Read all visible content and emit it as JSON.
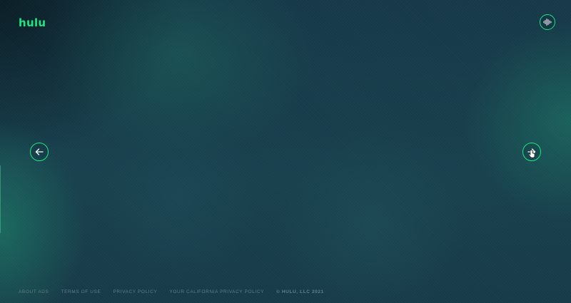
{
  "brand": {
    "logo_text": "hulu",
    "accent_color": "#1ce783"
  },
  "controls": {
    "audio_icon": "audio-wave-icon",
    "prev_icon": "arrow-left-icon",
    "next_icon": "arrow-right-icon"
  },
  "footer": {
    "links": [
      "ABOUT ADS",
      "TERMS OF USE",
      "PRIVACY POLICY",
      "YOUR CALIFORNIA PRIVACY POLICY"
    ],
    "copyright": "© HULU, LLC 2021"
  }
}
